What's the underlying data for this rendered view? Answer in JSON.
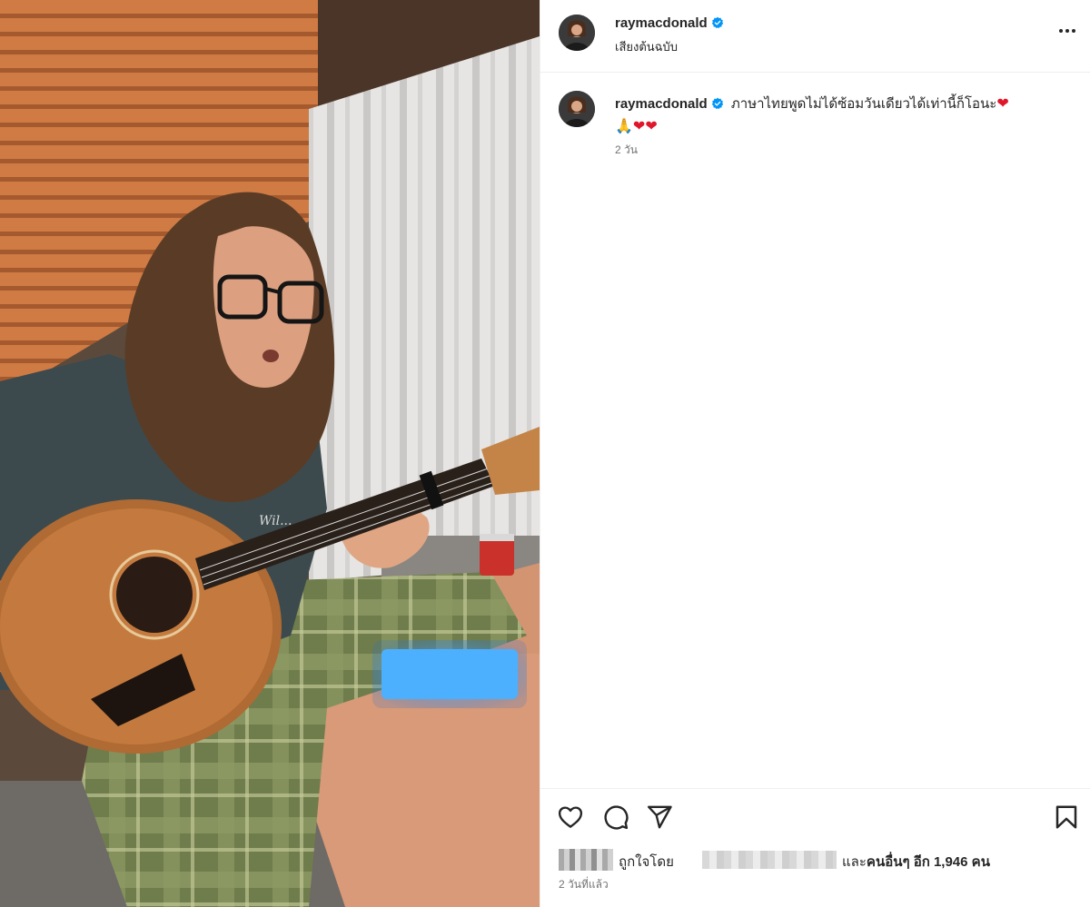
{
  "post": {
    "username": "raymacdonald",
    "audio_label": "เสียงต้นฉบับ",
    "more_icon": "more-horizontal-icon",
    "verified_color": "#0095f6"
  },
  "caption": {
    "username": "raymacdonald",
    "text": "ภาษาไทยพูดไม่ได้ซ้อมวันเดียวได้เท่านี้ก็โอนะ",
    "emojis_line1": "❤",
    "emojis_line2": "🙏❤❤",
    "time": "2 วัน"
  },
  "actions": {
    "like_icon": "heart-outline-icon",
    "comment_icon": "comment-bubble-icon",
    "share_icon": "paper-plane-icon",
    "save_icon": "bookmark-icon"
  },
  "likes": {
    "liked_by_prefix": "ถูกใจโดย",
    "and_others_prefix": "และ",
    "others_bold": "คนอื่นๆ อีก 1,946 คน"
  },
  "footer": {
    "post_time": "2 วันที่แล้ว"
  },
  "media": {
    "description_icon": "video-still-image"
  }
}
